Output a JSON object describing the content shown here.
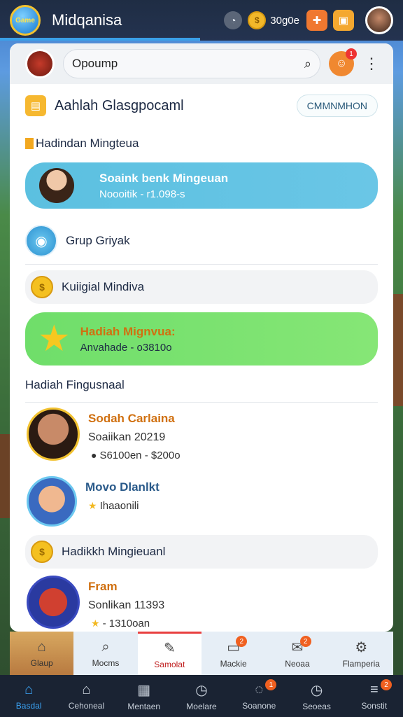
{
  "app": {
    "logo_text": "Game",
    "title": "Midqanisa",
    "coins": "30g0e"
  },
  "search": {
    "value": "Opoump",
    "mascot_badge": "1"
  },
  "section": {
    "title": "Aahlah Glasgpocaml",
    "button": "CMMNMHON"
  },
  "sublabel": "Hadindan Mingteua",
  "cards": [
    {
      "title": "Soaink benk Mingeuan",
      "sub": "Noooitik - r1.098-s"
    },
    {
      "title": "Hadiah Mignvua:",
      "sub": "Anvahade - o3810o"
    }
  ],
  "rows": [
    {
      "label": "Grup Griyak"
    },
    {
      "label": "Kuiigial Mindiva"
    }
  ],
  "heading2": "Hadiah Fingusnaal",
  "people": [
    {
      "name": "Sodah Carlaina",
      "sub": "Soaiikan 20219",
      "meta": "S6100en - $200o"
    },
    {
      "name": "Movo Dlanlkt",
      "sub": "",
      "meta": "Ihaaonili"
    },
    {
      "name": "Fram",
      "sub": "Sonlikan 11393",
      "meta": "- 1310oan"
    }
  ],
  "row3": {
    "label": "Hadikkh Mingieuanl"
  },
  "inner_tabs": [
    {
      "label": "Glaup",
      "icon": "home-icon",
      "badge": ""
    },
    {
      "label": "Mocms",
      "icon": "search-icon",
      "badge": ""
    },
    {
      "label": "Samolat",
      "icon": "edit-icon",
      "badge": ""
    },
    {
      "label": "Mackie",
      "icon": "chat-icon",
      "badge": "2"
    },
    {
      "label": "Neoaa",
      "icon": "mail-icon",
      "badge": "2"
    },
    {
      "label": "Flamperia",
      "icon": "settings-icon",
      "badge": ""
    }
  ],
  "os_nav": [
    {
      "label": "Basdal",
      "icon": "home-icon",
      "badge": ""
    },
    {
      "label": "Cehoneal",
      "icon": "house-icon",
      "badge": ""
    },
    {
      "label": "Mentaen",
      "icon": "calendar-icon",
      "badge": ""
    },
    {
      "label": "Moelare",
      "icon": "clock-icon",
      "badge": ""
    },
    {
      "label": "Soanone",
      "icon": "chat-icon",
      "badge": "1"
    },
    {
      "label": "Seoeas",
      "icon": "clock-icon",
      "badge": ""
    },
    {
      "label": "Sonstit",
      "icon": "menu-icon",
      "badge": "2"
    }
  ],
  "colors": {
    "accent": "#3aa0e8",
    "green_card": "#6fde6a",
    "blue_card": "#5bc0e0",
    "active_tab": "#e84040"
  }
}
